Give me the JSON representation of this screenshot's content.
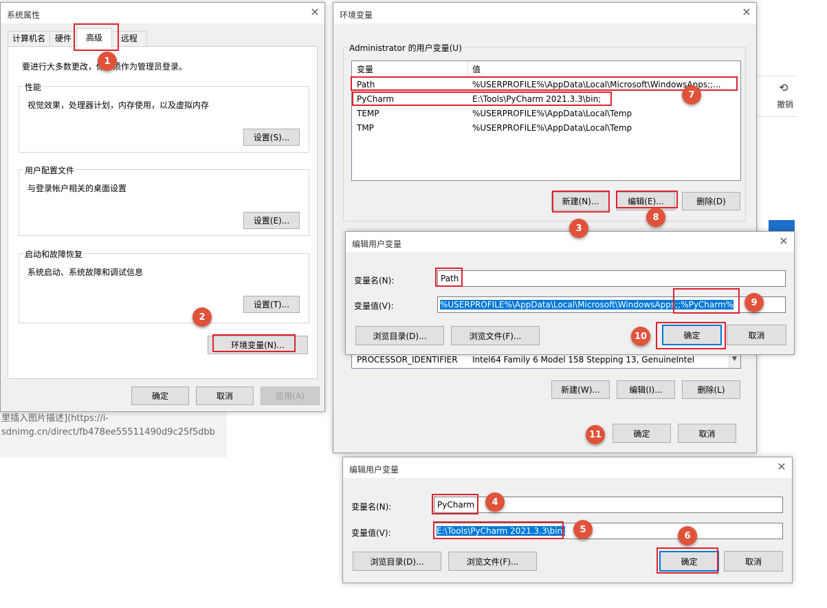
{
  "background": {
    "browser_text_1": "里插入图片描述](https://i-",
    "browser_text_2": "sdnimg.cn/direct/fb478ee55511490d9c25f5dbb",
    "undo_label": "撤销"
  },
  "sysprops": {
    "title": "系统属性",
    "tabs": [
      "计算机名",
      "硬件",
      "高级",
      "远程"
    ],
    "admin_note": "要进行大多数更改，你必须作为管理员登录。",
    "groups": [
      {
        "label": "性能",
        "desc": "视觉效果，处理器计划，内存使用，以及虚拟内存",
        "button": "设置(S)..."
      },
      {
        "label": "用户配置文件",
        "desc": "与登录帐户相关的桌面设置",
        "button": "设置(E)..."
      },
      {
        "label": "启动和故障恢复",
        "desc": "系统启动、系统故障和调试信息",
        "button": "设置(T)..."
      }
    ],
    "env_button": "环境变量(N)...",
    "ok": "确定",
    "cancel": "取消",
    "apply": "应用(A)"
  },
  "envvars": {
    "title": "环境变量",
    "user_group_label": "Administrator 的用户变量(U)",
    "col_var": "变量",
    "col_val": "值",
    "user_vars": [
      {
        "name": "Path",
        "value": "%USERPROFILE%\\AppData\\Local\\Microsoft\\WindowsApps;;..."
      },
      {
        "name": "PyCharm",
        "value": "E:\\Tools\\PyCharm 2021.3.3\\bin;"
      },
      {
        "name": "TEMP",
        "value": "%USERPROFILE%\\AppData\\Local\\Temp"
      },
      {
        "name": "TMP",
        "value": "%USERPROFILE%\\AppData\\Local\\Temp"
      }
    ],
    "user_new": "新建(N)...",
    "user_edit": "编辑(E)...",
    "user_delete": "删除(D)",
    "sys_row": {
      "name": "PROCESSOR_IDENTIFIER",
      "value": "Intel64 Family 6 Model 158 Stepping 13, GenuineIntel"
    },
    "sys_new": "新建(W)...",
    "sys_edit": "编辑(I)...",
    "sys_delete": "删除(L)",
    "ok": "确定",
    "cancel": "取消"
  },
  "edit1": {
    "title": "编辑用户变量",
    "name_label": "变量名(N):",
    "name_value": "Path",
    "value_label": "变量值(V):",
    "value_value": "%USERPROFILE%\\AppData\\Local\\Microsoft\\WindowsApps;;%PyCharm%",
    "browse_dir": "浏览目录(D)...",
    "browse_file": "浏览文件(F)...",
    "ok": "确定",
    "cancel": "取消"
  },
  "edit2": {
    "title": "编辑用户变量",
    "name_label": "变量名(N):",
    "name_value": "PyCharm",
    "value_label": "变量值(V):",
    "value_value": "E:\\Tools\\PyCharm 2021.3.3\\bin;",
    "browse_dir": "浏览目录(D)...",
    "browse_file": "浏览文件(F)...",
    "ok": "确定",
    "cancel": "取消"
  },
  "steps": [
    "1",
    "2",
    "3",
    "4",
    "5",
    "6",
    "7",
    "8",
    "9",
    "10",
    "11"
  ],
  "colors": {
    "annotation_red": "#e0202e",
    "step_badge": "#e0533a",
    "selection_blue": "#0078d7"
  }
}
